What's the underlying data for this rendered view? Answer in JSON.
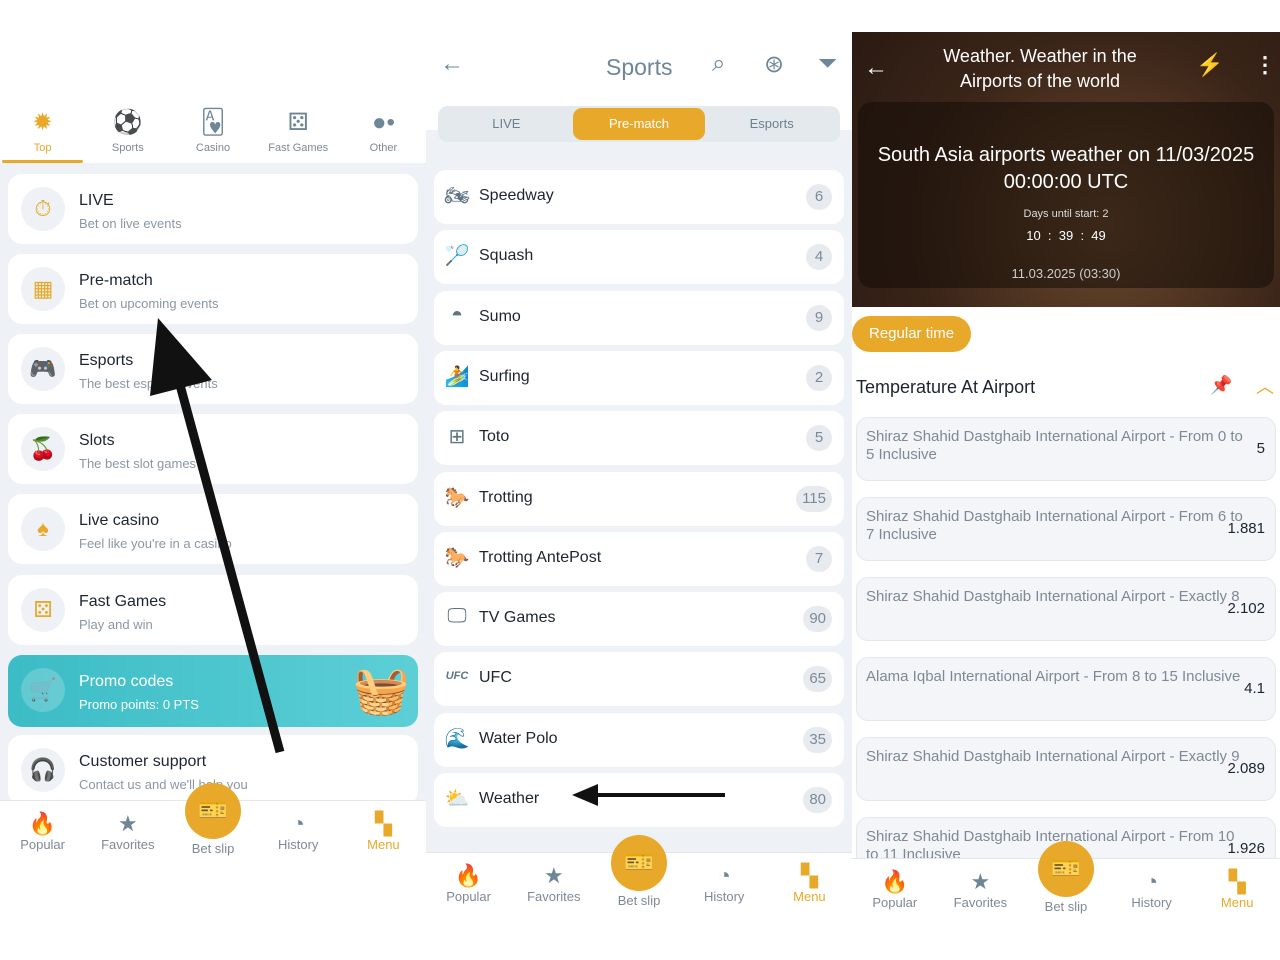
{
  "menu": {
    "tabs": [
      {
        "label": "Top",
        "icon": "star-badge-icon",
        "active": true
      },
      {
        "label": "Sports",
        "icon": "ball-icon"
      },
      {
        "label": "Casino",
        "icon": "cards-icon"
      },
      {
        "label": "Fast Games",
        "icon": "dice-icon"
      },
      {
        "label": "Other",
        "icon": "dots-icon"
      }
    ],
    "items": [
      {
        "title": "LIVE",
        "subtitle": "Bet on live events",
        "icon": "stopwatch-icon"
      },
      {
        "title": "Pre-match",
        "subtitle": "Bet on upcoming events",
        "icon": "calendar-icon"
      },
      {
        "title": "Esports",
        "subtitle": "The best esports events",
        "icon": "gamepad-icon"
      },
      {
        "title": "Slots",
        "subtitle": "The best slot games",
        "icon": "cherry-icon"
      },
      {
        "title": "Live casino",
        "subtitle": "Feel like you're in a casino",
        "icon": "spade-icon"
      },
      {
        "title": "Fast Games",
        "subtitle": "Play and win",
        "icon": "dice-icon"
      },
      {
        "title": "Promo codes",
        "subtitle": "Promo points: 0 PTS",
        "icon": "cart-icon"
      },
      {
        "title": "Customer support",
        "subtitle": "Contact us and we'll help you",
        "icon": "headset-icon"
      }
    ]
  },
  "nav": {
    "popular": "Popular",
    "favorites": "Favorites",
    "betslip": "Bet slip",
    "history": "History",
    "menu": "Menu"
  },
  "sports": {
    "title": "Sports",
    "segments": [
      "LIVE",
      "Pre-match",
      "Esports"
    ],
    "active_segment": "Pre-match",
    "rows": [
      {
        "name": "Speedway",
        "count": "6",
        "icon": "motorbike-icon"
      },
      {
        "name": "Squash",
        "count": "4",
        "icon": "racket-icon"
      },
      {
        "name": "Sumo",
        "count": "9",
        "icon": "sumo-icon"
      },
      {
        "name": "Surfing",
        "count": "2",
        "icon": "surfboard-icon"
      },
      {
        "name": "Toto",
        "count": "5",
        "icon": "grid-icon"
      },
      {
        "name": "Trotting",
        "count": "115",
        "icon": "horse-icon"
      },
      {
        "name": "Trotting AntePost",
        "count": "7",
        "icon": "horse-icon"
      },
      {
        "name": "TV Games",
        "count": "90",
        "icon": "tv-icon"
      },
      {
        "name": "UFC",
        "count": "65",
        "icon": "ufc-icon"
      },
      {
        "name": "Water Polo",
        "count": "35",
        "icon": "water-polo-icon"
      },
      {
        "name": "Weather",
        "count": "80",
        "icon": "weather-icon"
      }
    ]
  },
  "event": {
    "title": "Weather. Weather in the Airports of the world",
    "headline": "South Asia airports weather on 11/03/2025 00:00:00 UTC",
    "days_until": "Days until start: 2",
    "h": "10",
    "m": "39",
    "s": "49",
    "date": "11.03.2025 (03:30)",
    "period": "Regular time",
    "market": "Temperature At Airport",
    "odds": [
      {
        "name": "Shiraz Shahid Dastghaib International Airport - From 0 to 5 Inclusive",
        "value": "5"
      },
      {
        "name": "Shiraz Shahid Dastghaib International Airport - From 6 to 7 Inclusive",
        "value": "1.881"
      },
      {
        "name": "Shiraz Shahid Dastghaib International Airport - Exactly 8",
        "value": "2.102"
      },
      {
        "name": "Alama Iqbal International Airport - From 8 to 15 Inclusive",
        "value": "4.1"
      },
      {
        "name": "Shiraz Shahid Dastghaib International Airport - Exactly 9",
        "value": "2.089"
      },
      {
        "name": "Shiraz Shahid Dastghaib International Airport - From 10 to 11 Inclusive",
        "value": "1.926"
      }
    ]
  },
  "colors": {
    "accent": "#e8a92a",
    "promo": "#3cbcc6",
    "background": "#eef1f5"
  }
}
